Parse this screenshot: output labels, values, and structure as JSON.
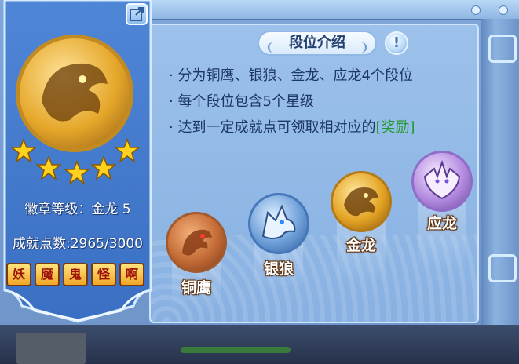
{
  "colors": {
    "accent_blue": "#2a5fa8",
    "reward_green": "#1e9a2a",
    "gold": "#e0a21f",
    "tag_text": "#9c1208"
  },
  "badge": {
    "stars_filled": 5,
    "stars_total": 5,
    "level_label": "徽章等级：金龙 5",
    "points_label": "成就点数:2965/3000",
    "tags": [
      "妖",
      "魔",
      "鬼",
      "怪",
      "啊"
    ]
  },
  "intro": {
    "title": "段位介绍",
    "rules": [
      "· 分为铜鹰、银狼、金龙、应龙4个段位",
      "· 每个段位包含5个星级",
      "· 达到一定成就点可领取相对应的"
    ],
    "reward_text": "[奖励]"
  },
  "tiers": [
    {
      "name": "铜鹰",
      "icon": "eagle-icon"
    },
    {
      "name": "银狼",
      "icon": "wolf-icon"
    },
    {
      "name": "金龙",
      "icon": "dragon-icon"
    },
    {
      "name": "应龙",
      "icon": "winged-dragon-icon"
    }
  ]
}
